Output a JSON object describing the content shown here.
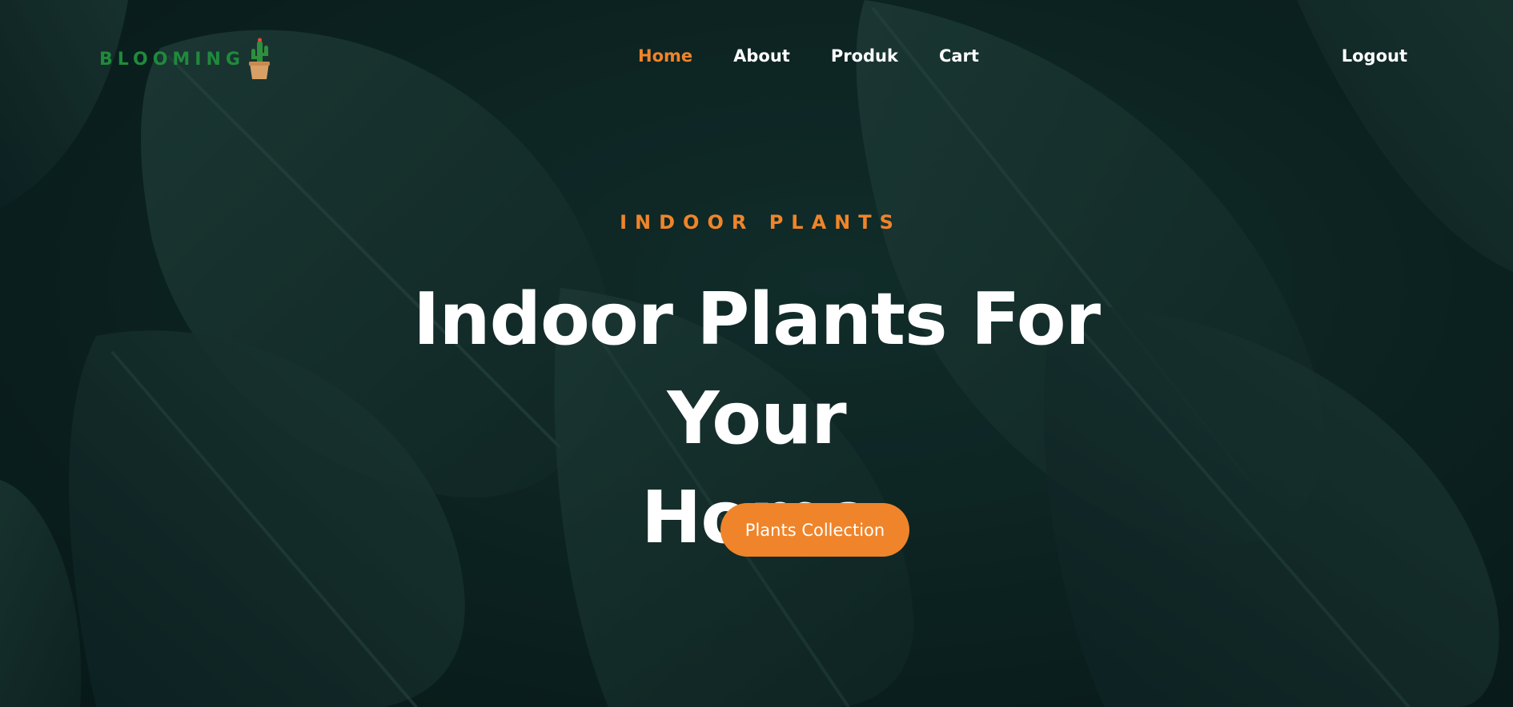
{
  "brand": {
    "name": "BLOOMING",
    "icon": "cactus-pot-icon",
    "color": "#1f8a3c"
  },
  "nav": {
    "items": [
      {
        "label": "Home",
        "active": true
      },
      {
        "label": "About",
        "active": false
      },
      {
        "label": "Produk",
        "active": false
      },
      {
        "label": "Cart",
        "active": false
      }
    ],
    "logout_label": "Logout"
  },
  "hero": {
    "eyebrow": "INDOOR PLANTS",
    "headline_line1": "Indoor Plants For Your",
    "headline_line2": "Home",
    "cta_label": "Plants Collection",
    "background": "monstera-leaves-image"
  },
  "colors": {
    "accent": "#f0842a",
    "text": "#ffffff",
    "background": "#0e2725"
  }
}
